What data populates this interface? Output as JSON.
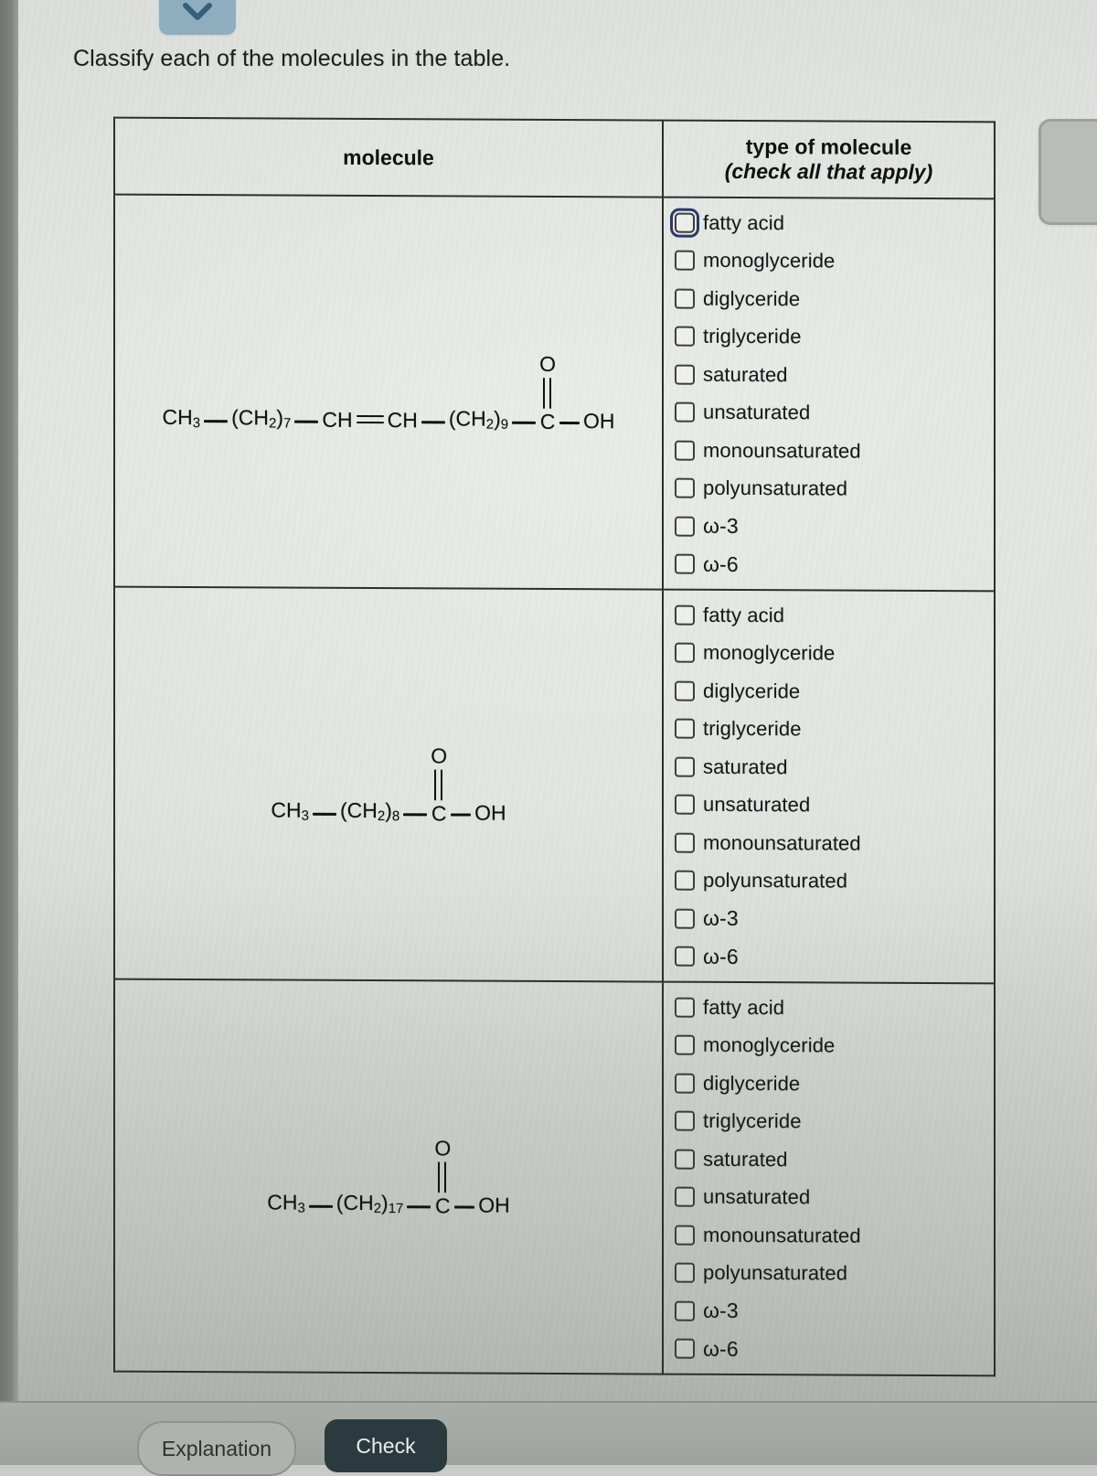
{
  "toolbar": {
    "chevron_icon": "chevron-down-icon"
  },
  "prompt": "Classify each of the molecules in the table.",
  "table": {
    "headers": {
      "molecule": "molecule",
      "type_line1": "type of molecule",
      "type_line2": "(check all that apply)"
    },
    "options": [
      "fatty acid",
      "monoglyceride",
      "diglyceride",
      "triglyceride",
      "saturated",
      "unsaturated",
      "monounsaturated",
      "polyunsaturated",
      "ω-3",
      "ω-6"
    ],
    "rows": [
      {
        "molecule_formula": "CH3—(CH2)7—CH=CH—(CH2)9—C(=O)—OH",
        "parts": {
          "ch3": "CH",
          "ch3_sub": "3",
          "ch2a": "(CH",
          "ch2a_sub": "2",
          "ch2a_close": ")",
          "ch2a_count": "7",
          "chA": "CH",
          "chB": "CH",
          "ch2b": "(CH",
          "ch2b_sub": "2",
          "ch2b_close": ")",
          "ch2b_count": "9",
          "oxygen": "O",
          "carbon": "C",
          "hydroxyl": "OH"
        },
        "checked": []
      },
      {
        "molecule_formula": "CH3—(CH2)8—C(=O)—OH",
        "parts": {
          "ch3": "CH",
          "ch3_sub": "3",
          "ch2a": "(CH",
          "ch2a_sub": "2",
          "ch2a_close": ")",
          "ch2a_count": "8",
          "oxygen": "O",
          "carbon": "C",
          "hydroxyl": "OH"
        },
        "checked": []
      },
      {
        "molecule_formula": "CH3—(CH2)17—C(=O)—OH",
        "parts": {
          "ch3": "CH",
          "ch3_sub": "3",
          "ch2a": "(CH",
          "ch2a_sub": "2",
          "ch2a_close": ")",
          "ch2a_count": "17",
          "oxygen": "O",
          "carbon": "C",
          "hydroxyl": "OH"
        },
        "checked": []
      }
    ]
  },
  "footer": {
    "explanation_label": "Explanation",
    "check_label": "Check"
  },
  "colors": {
    "chevron_button": "#8eaec0",
    "check_button": "#2b3a3e",
    "focus_ring": "#2b3a66",
    "table_border": "#2b2f2e",
    "page_background": "#d9dcd8"
  }
}
